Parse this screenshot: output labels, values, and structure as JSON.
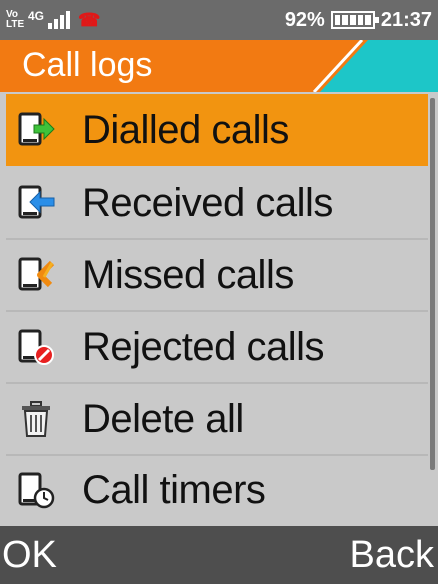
{
  "status_bar": {
    "volte": "Vo LTE",
    "network": "4G",
    "battery_percent": "92%",
    "battery_level": 0.92,
    "time": "21:37",
    "icons": [
      "volte-icon",
      "signal-icon",
      "call-icon",
      "battery-icon"
    ]
  },
  "title": "Call logs",
  "colors": {
    "title_bar": "#f27a12",
    "accent_teal": "#1dc6c8",
    "selected": "#f29410",
    "list_bg": "#c9c9c9",
    "softkey_bar": "#4e4e4e"
  },
  "menu": {
    "items": [
      {
        "label": "Dialled calls",
        "icon": "dialled-call-icon",
        "selected": true
      },
      {
        "label": "Received calls",
        "icon": "received-call-icon",
        "selected": false
      },
      {
        "label": "Missed calls",
        "icon": "missed-call-icon",
        "selected": false
      },
      {
        "label": "Rejected calls",
        "icon": "rejected-call-icon",
        "selected": false
      },
      {
        "label": "Delete all",
        "icon": "trash-icon",
        "selected": false
      },
      {
        "label": "Call timers",
        "icon": "call-timer-icon",
        "selected": false
      }
    ]
  },
  "softkeys": {
    "left": "OK",
    "right": "Back"
  }
}
